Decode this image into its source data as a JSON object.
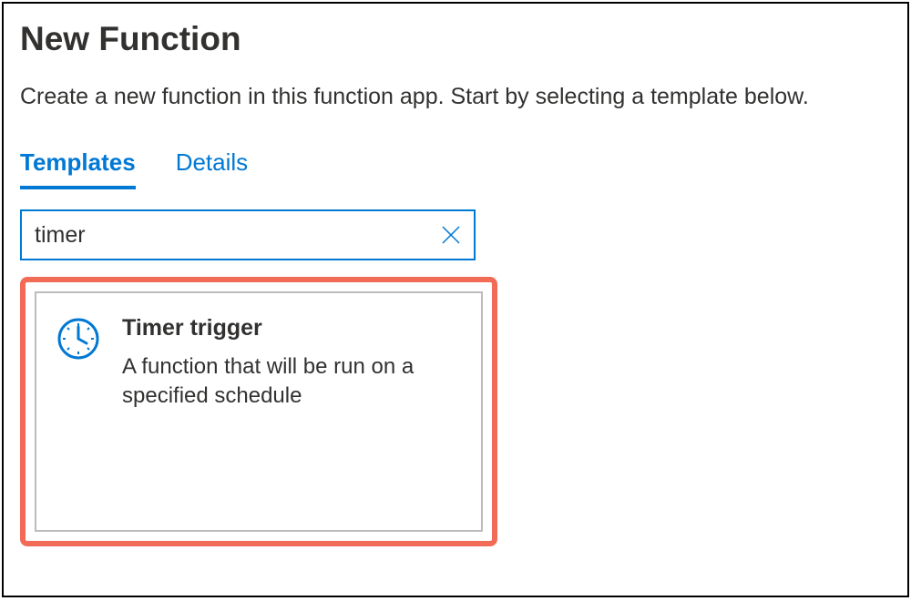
{
  "header": {
    "title": "New Function",
    "description": "Create a new function in this function app. Start by selecting a template below."
  },
  "tabs": [
    {
      "label": "Templates",
      "active": true
    },
    {
      "label": "Details",
      "active": false
    }
  ],
  "search": {
    "value": "timer"
  },
  "results": [
    {
      "title": "Timer trigger",
      "description": "A function that will be run on a specified schedule",
      "icon": "clock-icon"
    }
  ],
  "colors": {
    "accent": "#0078d4",
    "highlight": "#f26b56"
  }
}
